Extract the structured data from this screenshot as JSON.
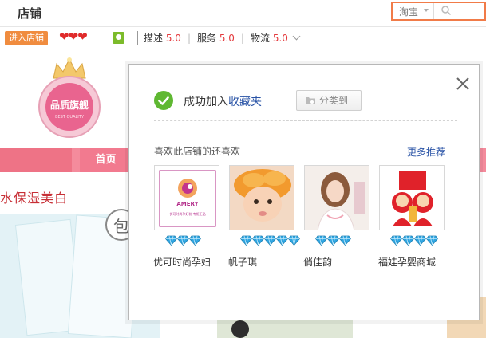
{
  "header": {
    "title": "店铺",
    "search_scope": "淘宝"
  },
  "shop_info": {
    "enter_label": "进入店铺",
    "hearts": "❤❤❤",
    "scores": [
      {
        "label": "描述",
        "value": "5.0"
      },
      {
        "label": "服务",
        "value": "5.0"
      },
      {
        "label": "物流",
        "value": "5.0"
      }
    ]
  },
  "background_shop": {
    "logo_text": "品质旗舰",
    "logo_subtext": "BEST QUALITY",
    "nav_home": "首页",
    "promo_text": "水保湿美白",
    "bag_glyph": "包"
  },
  "popup": {
    "success_prefix": "成功加入",
    "success_link": "收藏夹",
    "category_button": "分类到",
    "recommend_title": "喜欢此店铺的还喜欢",
    "more_link": "更多推荐",
    "shops": [
      {
        "name": "优可时尚孕妇",
        "diamonds": 3,
        "thumb_text": "AMERY",
        "thumb_sub": "优可时尚孕妇装  专柜正品"
      },
      {
        "name": "帆子琪",
        "diamonds": 5,
        "thumb_text": "",
        "thumb_sub": ""
      },
      {
        "name": "俏佳韵",
        "diamonds": 3,
        "thumb_text": "",
        "thumb_sub": ""
      },
      {
        "name": "福娃孕婴商城",
        "diamonds": 4,
        "thumb_text": "",
        "thumb_sub": ""
      }
    ]
  },
  "colors": {
    "accent_orange": "#f17b48",
    "link_blue": "#2953a6",
    "nav_pink": "#f48b9c",
    "success_green": "#5fb832",
    "diamond_blue": "#2ea4e0"
  },
  "icons": [
    "search-icon",
    "caret-down-icon",
    "heart-icon",
    "shop-badge-icon",
    "chevron-down-icon",
    "close-icon",
    "check-circle-icon",
    "folder-icon",
    "diamond-icon"
  ]
}
